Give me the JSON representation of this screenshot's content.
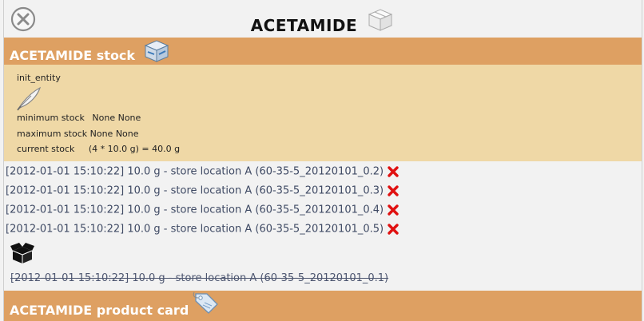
{
  "header": {
    "title": "ACETAMIDE"
  },
  "stock": {
    "band_label": "ACETAMIDE stock",
    "init_label": "init_entity",
    "min_label": "minimum stock",
    "min_value": "None None",
    "max_label": "maximum stock",
    "max_value": "None None",
    "current_label": "current stock",
    "current_value": "(4 * 10.0 g) = 40.0 g"
  },
  "entries": [
    {
      "text": "[2012-01-01 15:10:22] 10.0 g - store location A (60-35-5_20120101_0.2)"
    },
    {
      "text": "[2012-01-01 15:10:22] 10.0 g - store location A (60-35-5_20120101_0.3)"
    },
    {
      "text": "[2012-01-01 15:10:22] 10.0 g - store location A (60-35-5_20120101_0.4)"
    },
    {
      "text": "[2012-01-01 15:10:22] 10.0 g - store location A (60-35-5_20120101_0.5)"
    }
  ],
  "archived_entry": {
    "text": "[2012-01-01 15:10:22] 10.0 g - store location A (60-35-5_20120101_0.1)"
  },
  "product_card": {
    "band_label": "ACETAMIDE product card"
  },
  "icons": {
    "close": "close-circle-icon",
    "box_top": "box-icon",
    "stock": "stock-box-icon",
    "quill": "quill-icon",
    "delete": "delete-x-icon",
    "open_box": "open-box-icon",
    "tag": "tag-icon"
  },
  "colors": {
    "band": "#dea062",
    "panel": "#efd8a6",
    "delete": "#e01010"
  }
}
